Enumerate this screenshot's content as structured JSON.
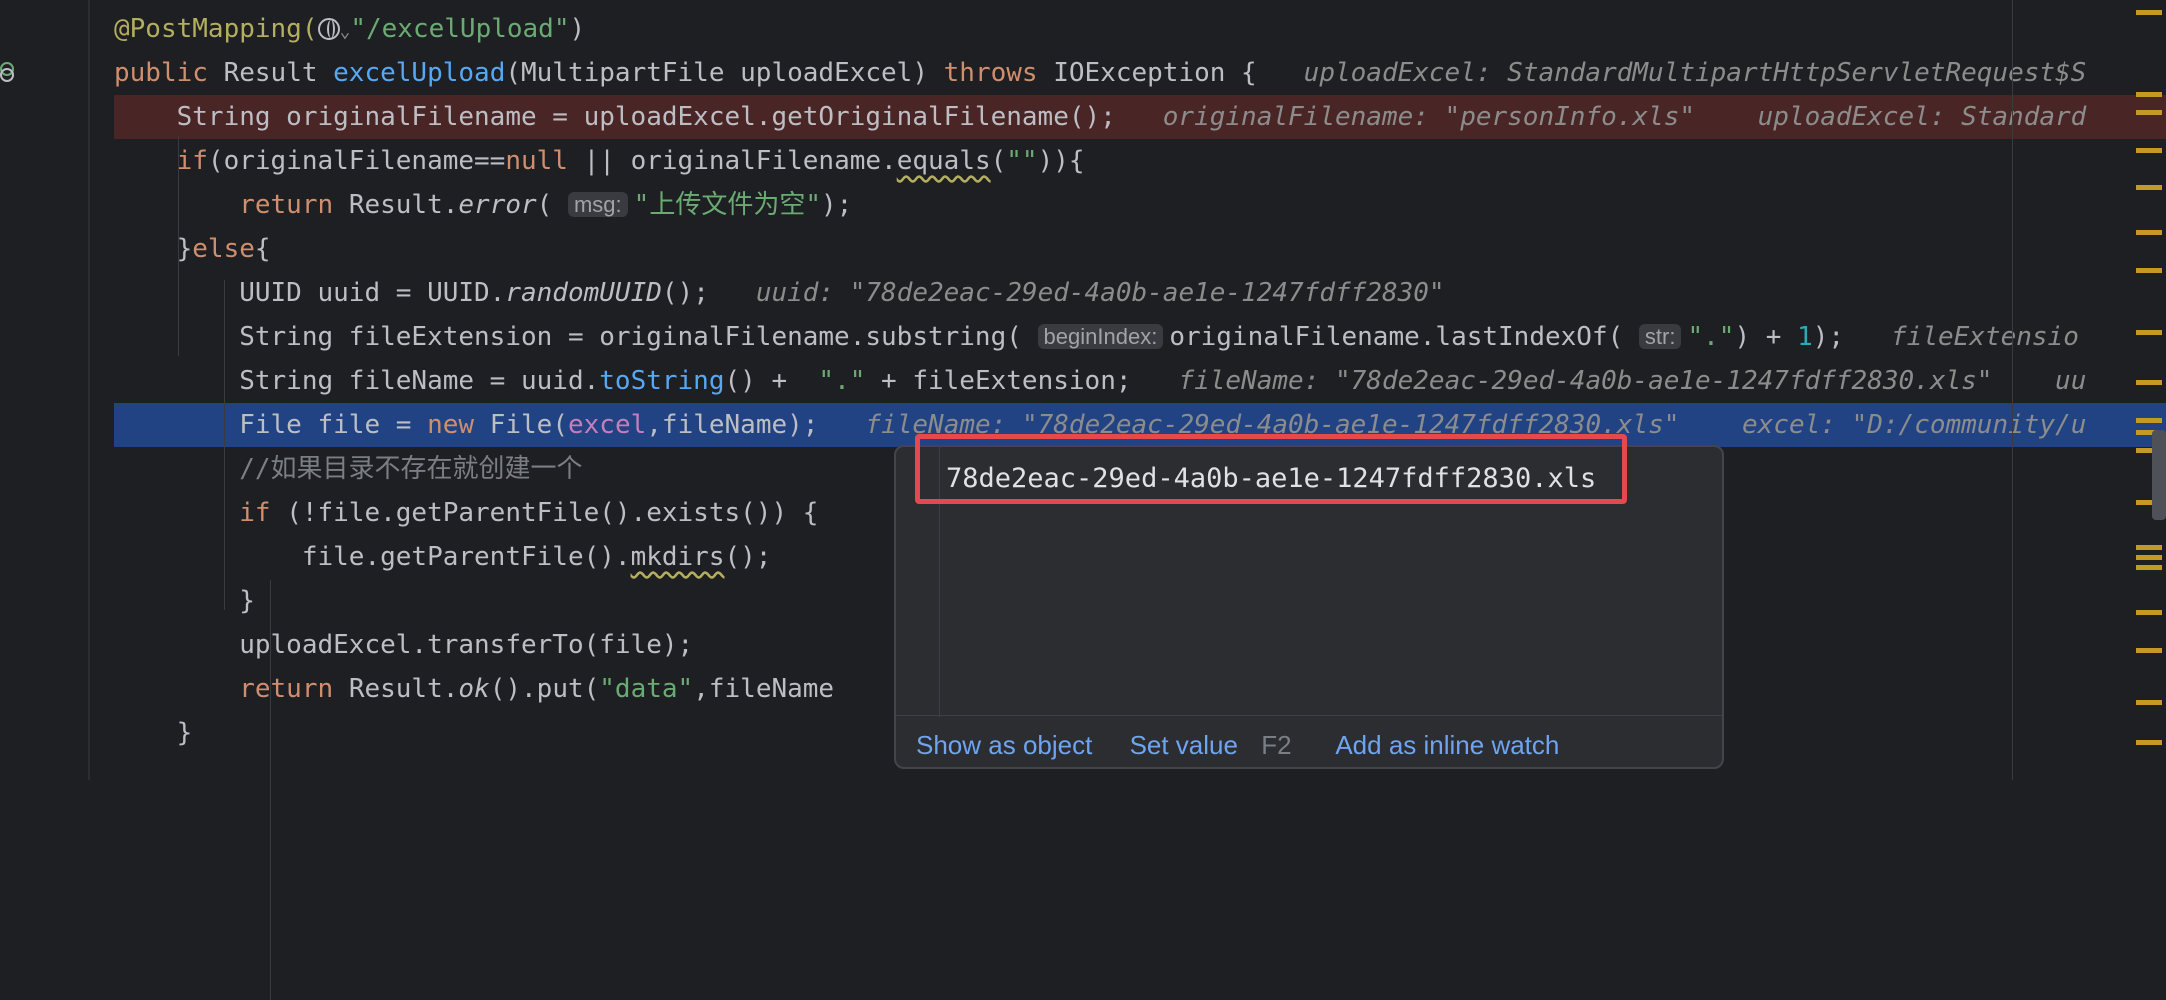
{
  "editor": {
    "lines": [
      {
        "id": "l1",
        "parts": [
          {
            "c": "ann",
            "t": "@PostMapping("
          },
          {
            "c": "globe"
          },
          {
            "c": "chev",
            "t": "⌄"
          },
          {
            "c": "str",
            "t": "\"/excelUpload\""
          },
          {
            "c": "",
            "t": ")"
          }
        ]
      },
      {
        "id": "l2",
        "parts": [
          {
            "c": "kw",
            "t": "public "
          },
          {
            "c": "",
            "t": "Result "
          },
          {
            "c": "fn",
            "t": "excelUpload"
          },
          {
            "c": "",
            "t": "(MultipartFile uploadExcel) "
          },
          {
            "c": "kw",
            "t": "throws "
          },
          {
            "c": "",
            "t": "IOException {   "
          },
          {
            "c": "inl",
            "t": "uploadExcel: StandardMultipartHttpServletRequest$S"
          }
        ]
      },
      {
        "id": "l3",
        "bg": "err",
        "parts": [
          {
            "c": "",
            "t": "    String originalFilename = uploadExcel.getOriginalFilename();   "
          },
          {
            "c": "inl",
            "t": "originalFilename: \"personInfo.xls\"    uploadExcel: Standard"
          }
        ]
      },
      {
        "id": "l4",
        "parts": [
          {
            "c": "kw",
            "t": "    if"
          },
          {
            "c": "",
            "t": "(originalFilename=="
          },
          {
            "c": "kw",
            "t": "null"
          },
          {
            "c": "",
            "t": " || originalFilename."
          },
          {
            "c": "wavy",
            "t": "equals"
          },
          {
            "c": "",
            "t": "("
          },
          {
            "c": "str",
            "t": "\"\""
          },
          {
            "c": "",
            "t": ")){"
          }
        ]
      },
      {
        "id": "l5",
        "parts": [
          {
            "c": "kw",
            "t": "        return "
          },
          {
            "c": "",
            "t": "Result."
          },
          {
            "c": "ital",
            "t": "error"
          },
          {
            "c": "",
            "t": "( "
          },
          {
            "c": "hint",
            "t": "msg:"
          },
          {
            "c": "str",
            "t": "\"上传文件为空\""
          },
          {
            "c": "",
            "t": ");"
          }
        ]
      },
      {
        "id": "l6",
        "parts": [
          {
            "c": "",
            "t": "    }"
          },
          {
            "c": "kw",
            "t": "else"
          },
          {
            "c": "",
            "t": "{"
          }
        ]
      },
      {
        "id": "l7",
        "parts": [
          {
            "c": "",
            "t": "        UUID uuid = UUID."
          },
          {
            "c": "ital",
            "t": "randomUUID"
          },
          {
            "c": "",
            "t": "();   "
          },
          {
            "c": "inl",
            "t": "uuid: \"78de2eac-29ed-4a0b-ae1e-1247fdff2830\""
          }
        ]
      },
      {
        "id": "l8",
        "parts": [
          {
            "c": "",
            "t": "        String fileExtension = originalFilename.substring( "
          },
          {
            "c": "hint",
            "t": "beginIndex:"
          },
          {
            "c": "",
            "t": "originalFilename.lastIndexOf( "
          },
          {
            "c": "hint",
            "t": "str:"
          },
          {
            "c": "str",
            "t": "\".\""
          },
          {
            "c": "",
            "t": ") + "
          },
          {
            "c": "num",
            "t": "1"
          },
          {
            "c": "",
            "t": ");   "
          },
          {
            "c": "inl",
            "t": "fileExtensio"
          }
        ]
      },
      {
        "id": "l9",
        "parts": [
          {
            "c": "",
            "t": "        String fileName = uuid."
          },
          {
            "c": "fn",
            "t": "toString"
          },
          {
            "c": "",
            "t": "() +  "
          },
          {
            "c": "str",
            "t": "\".\""
          },
          {
            "c": "",
            "t": " + fileExtension;   "
          },
          {
            "c": "inl",
            "t": "fileName: \"78de2eac-29ed-4a0b-ae1e-1247fdff2830.xls\"    uu"
          }
        ]
      },
      {
        "id": "l10",
        "bg": "cur",
        "parts": [
          {
            "c": "",
            "t": "        File file = "
          },
          {
            "c": "kw",
            "t": "new "
          },
          {
            "c": "",
            "t": "File("
          },
          {
            "c": "field",
            "t": "excel"
          },
          {
            "c": "",
            "t": ",fileName);   "
          },
          {
            "c": "inl",
            "t": "fileName: \"78de2eac-29ed-4a0b-ae1e-1247fdff2830.xls\"    excel: \"D:/community/u"
          }
        ]
      },
      {
        "id": "l11",
        "parts": [
          {
            "c": "cmt",
            "t": "        //如果目录不存在就创建一个"
          }
        ]
      },
      {
        "id": "l12",
        "parts": [
          {
            "c": "kw",
            "t": "        if "
          },
          {
            "c": "",
            "t": "(!file.getParentFile().exists()) {"
          }
        ]
      },
      {
        "id": "l13",
        "parts": [
          {
            "c": "",
            "t": "            file.getParentFile()."
          },
          {
            "c": "wavy",
            "t": "mkdirs"
          },
          {
            "c": "",
            "t": "();"
          }
        ]
      },
      {
        "id": "l14",
        "parts": [
          {
            "c": "",
            "t": "        }"
          }
        ]
      },
      {
        "id": "l15",
        "parts": [
          {
            "c": "",
            "t": "        uploadExcel.transferTo(file);"
          }
        ]
      },
      {
        "id": "l16",
        "parts": [
          {
            "c": "kw",
            "t": "        return "
          },
          {
            "c": "",
            "t": "Result."
          },
          {
            "c": "ital",
            "t": "ok"
          },
          {
            "c": "",
            "t": "().put("
          },
          {
            "c": "str",
            "t": "\"data\""
          },
          {
            "c": "",
            "t": ",fileName"
          }
        ]
      },
      {
        "id": "l17",
        "parts": [
          {
            "c": "",
            "t": "    }"
          }
        ]
      }
    ]
  },
  "popup": {
    "value": "78de2eac-29ed-4a0b-ae1e-1247fdff2830.xls",
    "show_as_object": "Show as object",
    "set_value": "Set value",
    "set_value_key": "F2",
    "add_inline_watch": "Add as inline watch"
  },
  "colors": {
    "background": "#1e1f22",
    "error_line": "#4a2525",
    "current_line": "#214283",
    "popup_bg": "#2b2d30",
    "highlight_border": "#e5484d",
    "link": "#6ea4f2"
  }
}
